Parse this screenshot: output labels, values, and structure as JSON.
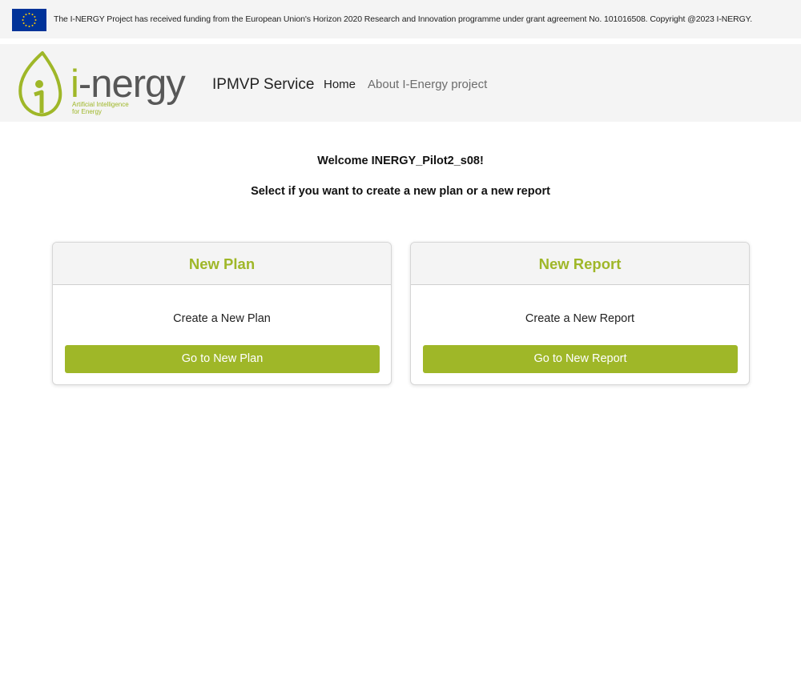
{
  "topbar": {
    "funding_text": "The I-NERGY Project has received funding from the European Union's Horizon 2020 Research and Innovation programme under grant agreement No. 101016508. Copyright @2023 I-NERGY.",
    "flag_icon": "eu-flag-icon"
  },
  "navbar": {
    "logo": {
      "word_first": "i",
      "word_rest": "-nergy",
      "tagline_line1": "Artificial Intelligence",
      "tagline_line2": "for Energy"
    },
    "brand": "IPMVP Service",
    "links": [
      {
        "label": "Home",
        "active": true
      },
      {
        "label": "About I-Energy project",
        "active": false
      }
    ]
  },
  "main": {
    "welcome": "Welcome INERGY_Pilot2_s08!",
    "instruction": "Select if you want to create a new plan or a new report",
    "cards": [
      {
        "title": "New Plan",
        "text": "Create a New Plan",
        "button": "Go to New Plan"
      },
      {
        "title": "New Report",
        "text": "Create a New Report",
        "button": "Go to New Report"
      }
    ]
  },
  "colors": {
    "accent": "#9fb728",
    "header_bg": "#f4f4f4",
    "eu_blue": "#003399",
    "eu_star": "#ffcc00"
  }
}
